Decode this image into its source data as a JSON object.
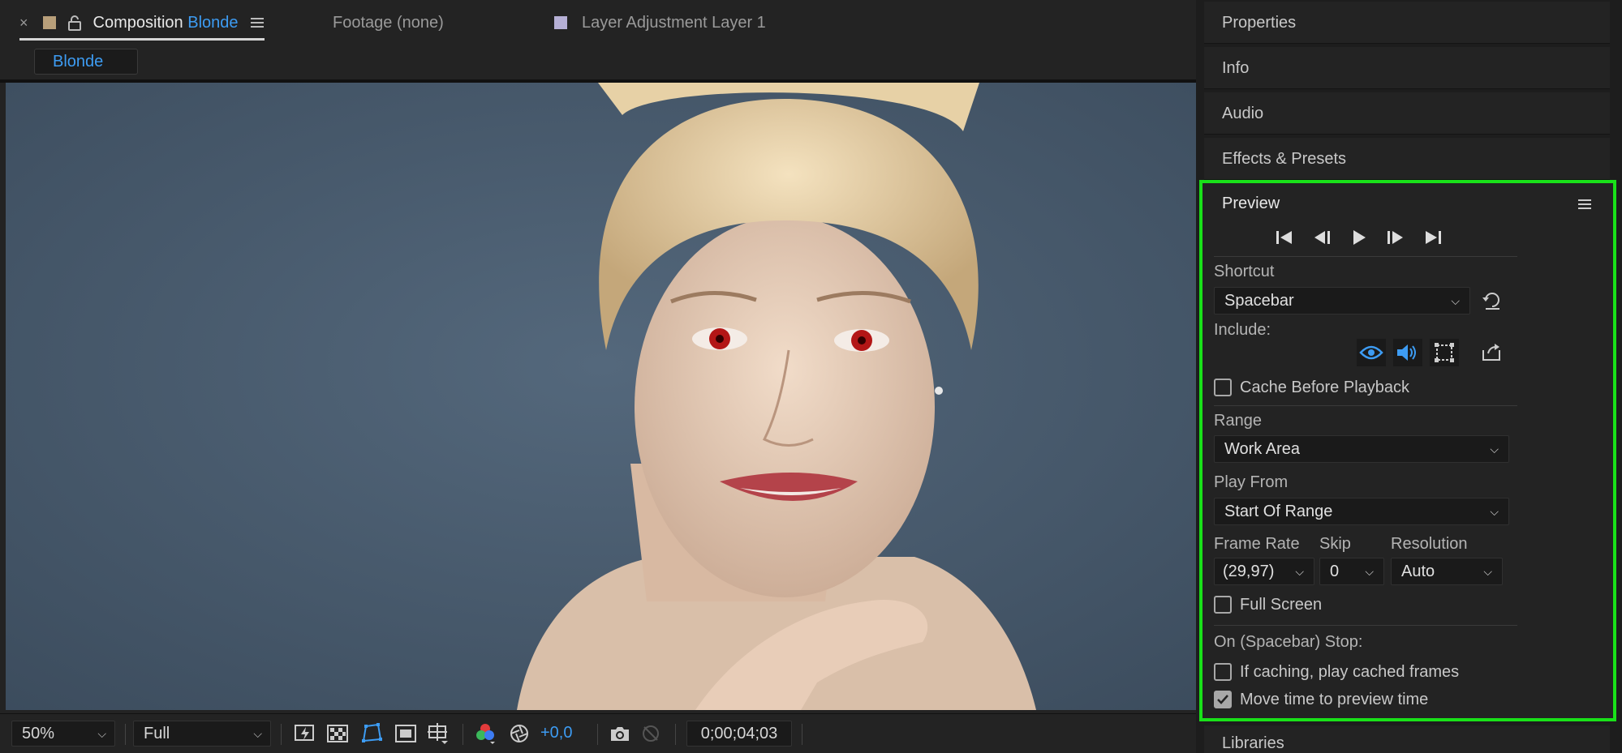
{
  "tabs": {
    "composition": {
      "prefix": "Composition",
      "name": "Blonde"
    },
    "footage": "Footage (none)",
    "layer": "Layer Adjustment Layer 1"
  },
  "comp_name": "Blonde",
  "bottom_bar": {
    "zoom": "50%",
    "resolution": "Full",
    "exposure": "+0,0",
    "timecode": "0;00;04;03"
  },
  "right_panels": [
    "Properties",
    "Info",
    "Audio",
    "Effects & Presets"
  ],
  "libraries": "Libraries",
  "preview": {
    "title": "Preview",
    "shortcut_label": "Shortcut",
    "shortcut_value": "Spacebar",
    "include_label": "Include:",
    "cache_before_playback": "Cache Before Playback",
    "range_label": "Range",
    "range_value": "Work Area",
    "play_from_label": "Play From",
    "play_from_value": "Start Of Range",
    "frame_rate_label": "Frame Rate",
    "skip_label": "Skip",
    "resolution_label": "Resolution",
    "frame_rate_value": "(29,97)",
    "skip_value": "0",
    "resolution_value": "Auto",
    "full_screen": "Full Screen",
    "on_stop_label": "On (Spacebar) Stop:",
    "if_caching": "If caching, play cached frames",
    "move_time": "Move time to preview time",
    "cache_checked": false,
    "full_screen_checked": false,
    "if_caching_checked": false,
    "move_time_checked": true
  },
  "colors": {
    "accent_blue": "#3d9cf3",
    "highlight_green": "#19e119",
    "comp_swatch": "#b89f7a",
    "layer_swatch": "#b6b0d6"
  }
}
